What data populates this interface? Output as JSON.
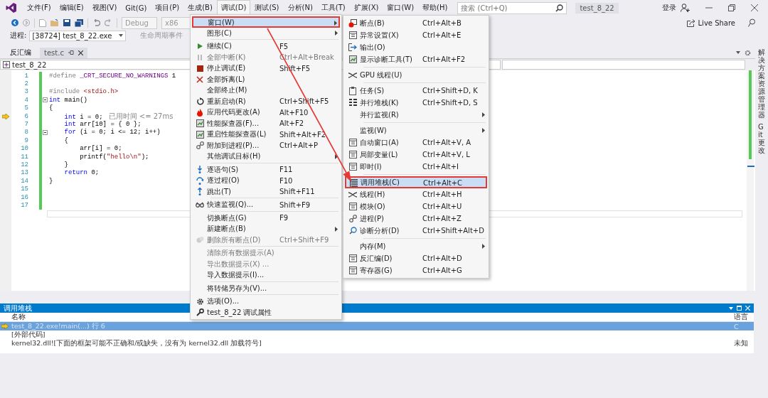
{
  "menu_bar": {
    "items": [
      {
        "label": "文件(F)",
        "selected": false
      },
      {
        "label": "编辑(E)",
        "selected": false
      },
      {
        "label": "视图(V)",
        "selected": false
      },
      {
        "label": "Git(G)",
        "selected": false
      },
      {
        "label": "项目(P)",
        "selected": false
      },
      {
        "label": "生成(B)",
        "selected": false
      },
      {
        "label": "调试(D)",
        "selected": true
      },
      {
        "label": "测试(S)",
        "selected": false
      },
      {
        "label": "分析(N)",
        "selected": false
      },
      {
        "label": "工具(T)",
        "selected": false
      },
      {
        "label": "扩展(X)",
        "selected": false
      },
      {
        "label": "窗口(W)",
        "selected": false
      },
      {
        "label": "帮助(H)",
        "selected": false
      }
    ]
  },
  "search": {
    "placeholder": "搜索 (Ctrl+Q)"
  },
  "solution_name": "test_8_22",
  "account": {
    "label": "登录"
  },
  "toolbar": {
    "configuration": "Debug",
    "platform": "x86",
    "live_share": "Live Share"
  },
  "debug_location": {
    "label": "进程:",
    "process": "[38724] test_8_22.exe",
    "lifecycle": "生命周期事件"
  },
  "document_tabs": [
    {
      "label": "反汇编",
      "selected": false
    },
    {
      "label": "test.c",
      "selected": true
    }
  ],
  "navigation_bar": {
    "project": "test_8_22"
  },
  "editor": {
    "lines": [
      {
        "number": "1",
        "tokens": [
          {
            "text": "#define ",
            "kind": "pre"
          },
          {
            "text": "_CRT_SECURE_NO_WARNINGS",
            "kind": "macro"
          },
          {
            "text": " 1",
            "kind": "plain"
          }
        ]
      },
      {
        "number": "2"
      },
      {
        "number": "3",
        "tokens": [
          {
            "text": "#include ",
            "kind": "pre"
          },
          {
            "text": "<stdio.h>",
            "kind": "str"
          }
        ]
      },
      {
        "number": "4",
        "foldable": true,
        "tokens": [
          {
            "text": "int",
            "kind": "kw"
          },
          {
            "text": " main()",
            "kind": "plain"
          }
        ]
      },
      {
        "number": "5",
        "tokens": [
          {
            "text": "{",
            "kind": "plain"
          }
        ]
      },
      {
        "number": "6",
        "current": true,
        "tokens": [
          {
            "text": "    int",
            "kind": "kw"
          },
          {
            "text": " i = 0;",
            "kind": "plain"
          },
          {
            "text": "已用时间 <= 27ms",
            "kind": "hint"
          }
        ]
      },
      {
        "number": "7",
        "tokens": [
          {
            "text": "    int",
            "kind": "kw"
          },
          {
            "text": " arr[10] = { 0 };",
            "kind": "plain"
          }
        ]
      },
      {
        "number": "8",
        "foldable": true,
        "tokens": [
          {
            "text": "    for",
            "kind": "kw"
          },
          {
            "text": " (i = 0; i <= 12; i++)",
            "kind": "plain"
          }
        ]
      },
      {
        "number": "9",
        "tokens": [
          {
            "text": "    {",
            "kind": "plain"
          }
        ]
      },
      {
        "number": "10",
        "tokens": [
          {
            "text": "        arr[i] = 0;",
            "kind": "plain"
          }
        ]
      },
      {
        "number": "11",
        "tokens": [
          {
            "text": "        printf(",
            "kind": "plain"
          },
          {
            "text": "\"hello\\n\"",
            "kind": "str"
          },
          {
            "text": ");",
            "kind": "plain"
          }
        ]
      },
      {
        "number": "12",
        "tokens": [
          {
            "text": "    }",
            "kind": "plain"
          }
        ]
      },
      {
        "number": "13",
        "tokens": [
          {
            "text": "    return",
            "kind": "kw"
          },
          {
            "text": " 0;",
            "kind": "plain"
          }
        ]
      },
      {
        "number": "14",
        "tokens": [
          {
            "text": "}",
            "kind": "plain"
          }
        ]
      },
      {
        "number": "15"
      },
      {
        "number": "16"
      },
      {
        "number": "17"
      }
    ]
  },
  "side_tabs": [
    {
      "label": "解决方案资源管理器"
    },
    {
      "label": "Git 更改"
    }
  ],
  "call_stack": {
    "title": "调用堆栈",
    "columns": [
      "名称",
      "语言"
    ],
    "rows": [
      {
        "name": "test_8_22.exe!main(...) 行 6",
        "language": "C",
        "selected": true,
        "current": true
      },
      {
        "name": "[外部代码]",
        "selected": false,
        "current": false
      },
      {
        "name": "kernel32.dll![下面的框架可能不正确和/或缺失，没有为 kernel32.dll 加载符号]",
        "language": "未知",
        "selected": false,
        "current": false
      }
    ]
  },
  "debug_menu": {
    "items": [
      {
        "kind": "item",
        "label": "窗口(W)",
        "submenu": true,
        "selected": true,
        "annotated": true
      },
      {
        "kind": "item",
        "label": "图形(C)",
        "submenu": true
      },
      {
        "kind": "separator"
      },
      {
        "kind": "item",
        "label": "继续(C)",
        "shortcut": "F5"
      },
      {
        "kind": "item",
        "label": "全部中断(K)",
        "shortcut": "Ctrl+Alt+Break",
        "disabled": true
      },
      {
        "kind": "item",
        "label": "停止调试(E)",
        "shortcut": "Shift+F5"
      },
      {
        "kind": "item",
        "label": "全部拆离(L)"
      },
      {
        "kind": "item",
        "label": "全部终止(M)"
      },
      {
        "kind": "item",
        "label": "重新启动(R)",
        "shortcut": "Ctrl+Shift+F5"
      },
      {
        "kind": "item",
        "label": "应用代码更改(A)",
        "shortcut": "Alt+F10"
      },
      {
        "kind": "item",
        "label": "性能探查器(F)...",
        "shortcut": "Alt+F2"
      },
      {
        "kind": "item",
        "label": "重启性能探查器(L)",
        "shortcut": "Shift+Alt+F2"
      },
      {
        "kind": "item",
        "label": "附加到进程(P)...",
        "shortcut": "Ctrl+Alt+P"
      },
      {
        "kind": "item",
        "label": "其他调试目标(H)",
        "submenu": true
      },
      {
        "kind": "separator"
      },
      {
        "kind": "item",
        "label": "逐语句(S)",
        "shortcut": "F11"
      },
      {
        "kind": "item",
        "label": "逐过程(O)",
        "shortcut": "F10"
      },
      {
        "kind": "item",
        "label": "跳出(T)",
        "shortcut": "Shift+F11"
      },
      {
        "kind": "separator"
      },
      {
        "kind": "item",
        "label": "快速监视(Q)...",
        "shortcut": "Shift+F9"
      },
      {
        "kind": "separator"
      },
      {
        "kind": "item",
        "label": "切换断点(G)",
        "shortcut": "F9"
      },
      {
        "kind": "item",
        "label": "新建断点(B)",
        "submenu": true
      },
      {
        "kind": "item",
        "label": "删除所有断点(D)",
        "shortcut": "Ctrl+Shift+F9",
        "disabled": true
      },
      {
        "kind": "separator"
      },
      {
        "kind": "item",
        "label": "清除所有数据提示(A)",
        "disabled": true
      },
      {
        "kind": "item",
        "label": "导出数据提示(X) ...",
        "disabled": true
      },
      {
        "kind": "item",
        "label": "导入数据提示(I)..."
      },
      {
        "kind": "separator"
      },
      {
        "kind": "item",
        "label": "将转储另存为(V)..."
      },
      {
        "kind": "separator"
      },
      {
        "kind": "item",
        "label": "选项(O)..."
      },
      {
        "kind": "item",
        "label": "test_8_22 调试属性"
      }
    ]
  },
  "window_submenu": {
    "items": [
      {
        "kind": "item",
        "label": "断点(B)",
        "shortcut": "Ctrl+Alt+B"
      },
      {
        "kind": "item",
        "label": "异常设置(X)",
        "shortcut": "Ctrl+Alt+E"
      },
      {
        "kind": "item",
        "label": "输出(O)"
      },
      {
        "kind": "item",
        "label": "显示诊断工具(T)",
        "shortcut": "Ctrl+Alt+F2"
      },
      {
        "kind": "separator"
      },
      {
        "kind": "item",
        "label": "GPU 线程(U)"
      },
      {
        "kind": "separator"
      },
      {
        "kind": "item",
        "label": "任务(S)",
        "shortcut": "Ctrl+Shift+D, K"
      },
      {
        "kind": "item",
        "label": "并行堆栈(K)",
        "shortcut": "Ctrl+Shift+D, S"
      },
      {
        "kind": "item",
        "label": "并行监视(R)",
        "submenu": true
      },
      {
        "kind": "separator"
      },
      {
        "kind": "item",
        "label": "监视(W)",
        "submenu": true
      },
      {
        "kind": "item",
        "label": "自动窗口(A)",
        "shortcut": "Ctrl+Alt+V, A"
      },
      {
        "kind": "item",
        "label": "局部变量(L)",
        "shortcut": "Ctrl+Alt+V, L"
      },
      {
        "kind": "item",
        "label": "即时(I)",
        "shortcut": "Ctrl+Alt+I"
      },
      {
        "kind": "separator"
      },
      {
        "kind": "item",
        "label": "调用堆栈(C)",
        "shortcut": "Ctrl+Alt+C",
        "selected": true,
        "annotated": true
      },
      {
        "kind": "item",
        "label": "线程(H)",
        "shortcut": "Ctrl+Alt+H"
      },
      {
        "kind": "item",
        "label": "模块(O)",
        "shortcut": "Ctrl+Alt+U"
      },
      {
        "kind": "item",
        "label": "进程(P)",
        "shortcut": "Ctrl+Alt+Z"
      },
      {
        "kind": "item",
        "label": "诊断分析(D)",
        "shortcut": "Ctrl+Shift+Alt+D"
      },
      {
        "kind": "separator"
      },
      {
        "kind": "item",
        "label": "内存(M)",
        "submenu": true
      },
      {
        "kind": "item",
        "label": "反汇编(D)",
        "shortcut": "Ctrl+Alt+D"
      },
      {
        "kind": "item",
        "label": "寄存器(G)",
        "shortcut": "Ctrl+Alt+G"
      }
    ]
  }
}
